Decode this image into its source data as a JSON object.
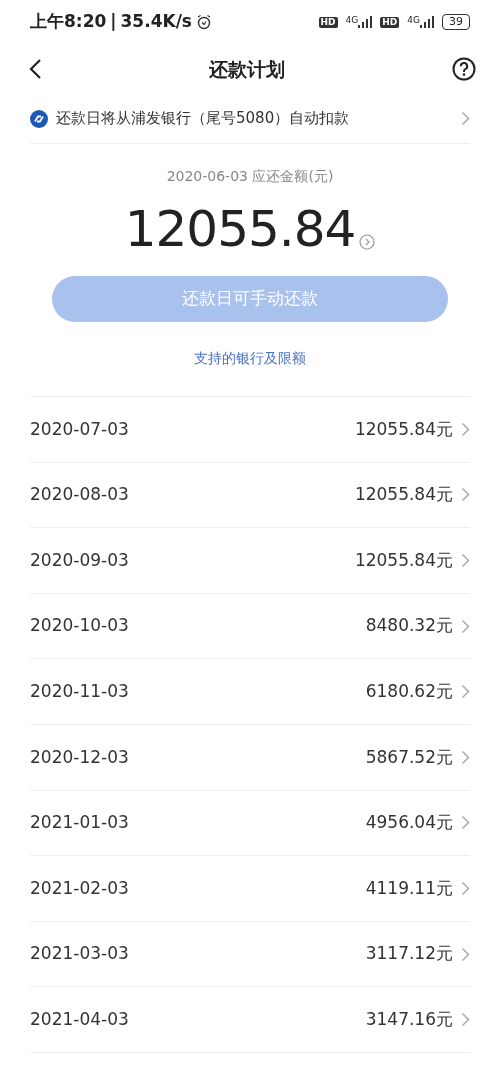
{
  "status_bar": {
    "time": "上午8:20",
    "separator": "|",
    "speed": "35.4K/s",
    "sims": [
      {
        "hd": "HD",
        "network": "4G"
      },
      {
        "hd": "HD",
        "network": "4G"
      }
    ],
    "battery": "39"
  },
  "header": {
    "title": "还款计划"
  },
  "autopay_notice": "还款日将从浦发银行（尾号5080）自动扣款",
  "summary": {
    "label": "2020-06-03 应还金额(元)",
    "amount": "12055.84"
  },
  "pay_button": {
    "label": "还款日可手动还款",
    "disabled": true
  },
  "banks_link": "支持的银行及限额",
  "installments": [
    {
      "date": "2020-07-03",
      "amount": "12055.84元"
    },
    {
      "date": "2020-08-03",
      "amount": "12055.84元"
    },
    {
      "date": "2020-09-03",
      "amount": "12055.84元"
    },
    {
      "date": "2020-10-03",
      "amount": "8480.32元"
    },
    {
      "date": "2020-11-03",
      "amount": "6180.62元"
    },
    {
      "date": "2020-12-03",
      "amount": "5867.52元"
    },
    {
      "date": "2021-01-03",
      "amount": "4956.04元"
    },
    {
      "date": "2021-02-03",
      "amount": "4119.11元"
    },
    {
      "date": "2021-03-03",
      "amount": "3117.12元"
    },
    {
      "date": "2021-04-03",
      "amount": "3147.16元"
    }
  ]
}
